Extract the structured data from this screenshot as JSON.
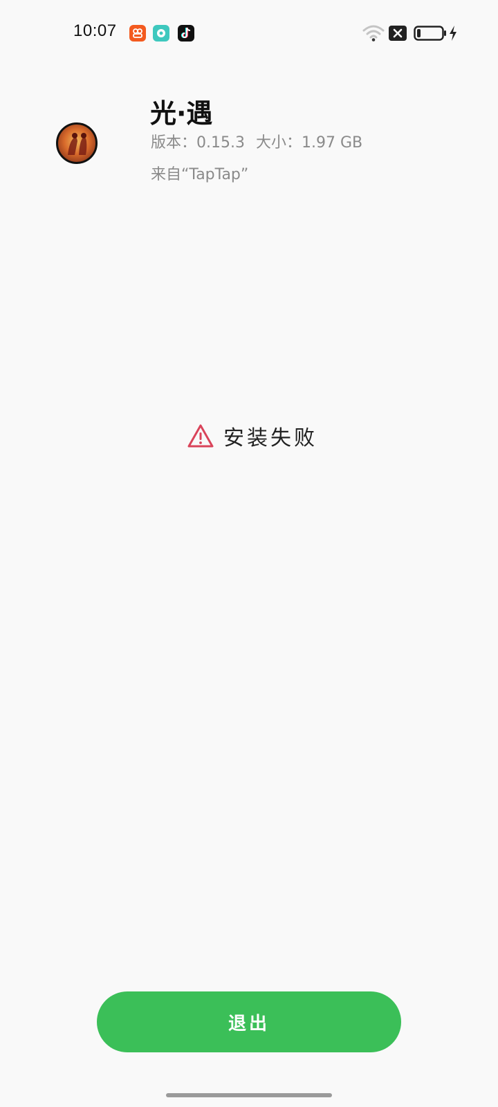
{
  "status_bar": {
    "time": "10:07",
    "notification_icons": [
      "app-orange-icon",
      "app-teal-icon",
      "tiktok-icon"
    ],
    "system_icons": [
      "wifi-icon",
      "no-sim-icon",
      "battery-icon",
      "charging-icon"
    ],
    "battery_level": 0.15
  },
  "app": {
    "name": "光·遇",
    "version_label": "版本：",
    "version": "0.15.3",
    "size_label": "大小：",
    "size": "1.97 GB",
    "source": "来自“TapTap”"
  },
  "status": {
    "message": "安装失败",
    "icon": "warning-triangle-icon",
    "icon_color": "#d9445a"
  },
  "actions": {
    "exit_label": "退出",
    "exit_color": "#3bbf58"
  }
}
